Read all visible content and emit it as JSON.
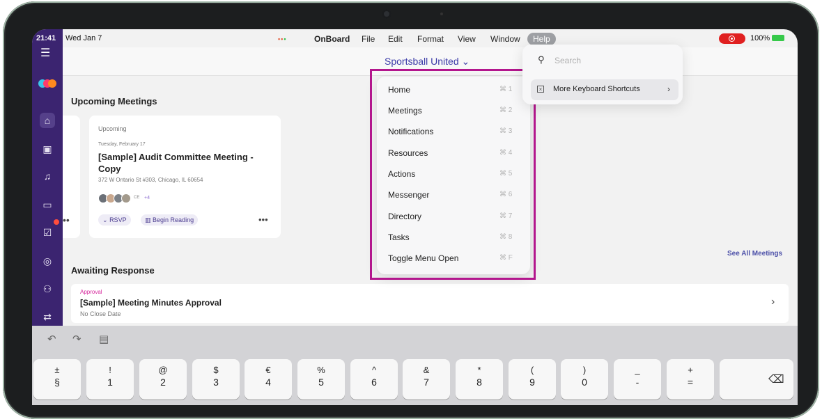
{
  "status": {
    "time": "21:41",
    "date": "Wed Jan 7",
    "battery": "100%"
  },
  "menubar": {
    "app": "OnBoard",
    "items": [
      "File",
      "Edit",
      "Format",
      "View",
      "Window",
      "Help"
    ]
  },
  "header": {
    "organization": "Sportsball United"
  },
  "upcoming": {
    "heading": "Upcoming Meetings",
    "card": {
      "label": "Upcoming",
      "date": "Tuesday, February 17",
      "title": "[Sample] Audit Committee Meeting - Copy",
      "address": "372 W Ontario St #303, Chicago, IL 60654",
      "attendee_initials": "CE",
      "attendee_more": "+4",
      "rsvp_label": "RSVP",
      "reading_label": "Begin Reading"
    },
    "see_all": "See All Meetings"
  },
  "awaiting": {
    "heading": "Awaiting Response",
    "item": {
      "kind": "Approval",
      "title": "[Sample] Meeting Minutes Approval",
      "subtitle": "No Close Date"
    }
  },
  "shortcuts_menu": [
    {
      "label": "Home",
      "shortcut": "⌘ 1"
    },
    {
      "label": "Meetings",
      "shortcut": "⌘ 2"
    },
    {
      "label": "Notifications",
      "shortcut": "⌘ 3"
    },
    {
      "label": "Resources",
      "shortcut": "⌘ 4"
    },
    {
      "label": "Actions",
      "shortcut": "⌘ 5"
    },
    {
      "label": "Messenger",
      "shortcut": "⌘ 6"
    },
    {
      "label": "Directory",
      "shortcut": "⌘ 7"
    },
    {
      "label": "Tasks",
      "shortcut": "⌘ 8"
    },
    {
      "label": "Toggle Menu Open",
      "shortcut": "⌘ F"
    }
  ],
  "help_panel": {
    "search_placeholder": "Search",
    "more_shortcuts": "More Keyboard Shortcuts"
  },
  "keyboard": {
    "keys": [
      {
        "upper": "±",
        "lower": "§"
      },
      {
        "upper": "!",
        "lower": "1"
      },
      {
        "upper": "@",
        "lower": "2"
      },
      {
        "upper": "$",
        "lower": "3"
      },
      {
        "upper": "€",
        "lower": "4"
      },
      {
        "upper": "%",
        "lower": "5"
      },
      {
        "upper": "^",
        "lower": "6"
      },
      {
        "upper": "&",
        "lower": "7"
      },
      {
        "upper": "*",
        "lower": "8"
      },
      {
        "upper": "(",
        "lower": "9"
      },
      {
        "upper": ")",
        "lower": "0"
      },
      {
        "upper": "_",
        "lower": "-"
      },
      {
        "upper": "+",
        "lower": "="
      }
    ]
  },
  "colors": {
    "rail": "#3b2470",
    "accent": "#3a3aa8",
    "highlight_border": "#b3168d",
    "approval_label": "#d6279d"
  }
}
